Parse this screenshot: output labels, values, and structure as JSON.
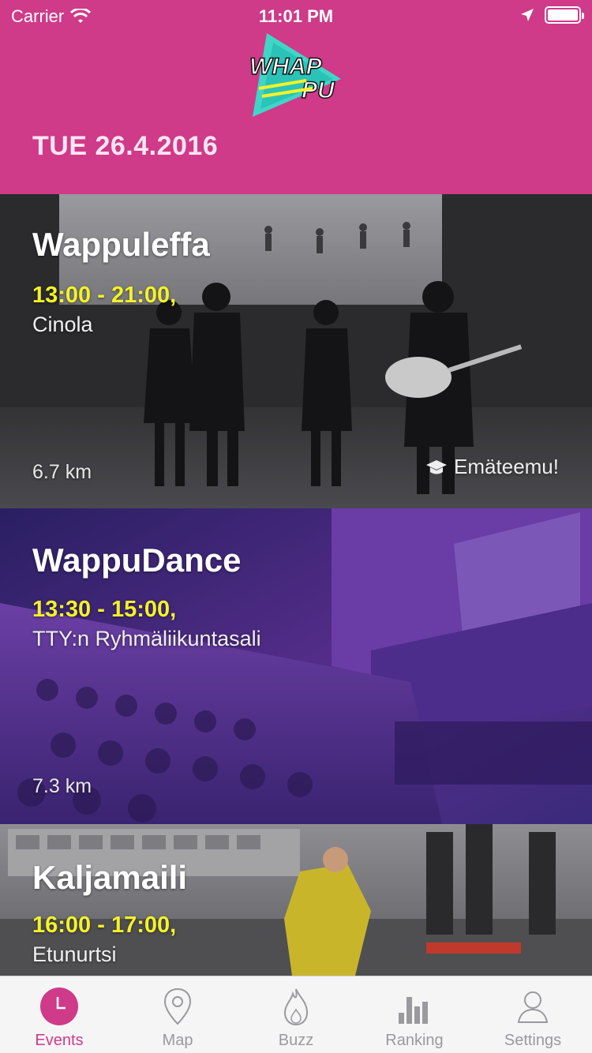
{
  "status_bar": {
    "carrier": "Carrier",
    "time": "11:01 PM"
  },
  "header": {
    "logo_text_top": "WHAP",
    "logo_text_bottom": "PU",
    "date": "TUE 26.4.2016",
    "bg_color": "#cf3a89"
  },
  "events": [
    {
      "title": "Wappuleffa",
      "time": "13:00 - 21:00,",
      "place": "Cinola",
      "distance": "6.7 km",
      "tag": "Emäteemu!",
      "tag_icon": "graduation-cap-icon"
    },
    {
      "title": "WappuDance",
      "time": "13:30 - 15:00,",
      "place": "TTY:n Ryhmäliikuntasali",
      "distance": "7.3 km"
    },
    {
      "title": "Kaljamaili",
      "time": "16:00 - 17:00,",
      "place": "Etunurtsi"
    }
  ],
  "tabs": [
    {
      "label": "Events",
      "icon": "clock-icon",
      "active": true
    },
    {
      "label": "Map",
      "icon": "map-pin-icon",
      "active": false
    },
    {
      "label": "Buzz",
      "icon": "flame-icon",
      "active": false
    },
    {
      "label": "Ranking",
      "icon": "bar-chart-icon",
      "active": false
    },
    {
      "label": "Settings",
      "icon": "person-icon",
      "active": false
    }
  ],
  "colors": {
    "accent": "#cf3a89",
    "event_time": "#f4f227",
    "tab_inactive": "#9a9a9e"
  }
}
